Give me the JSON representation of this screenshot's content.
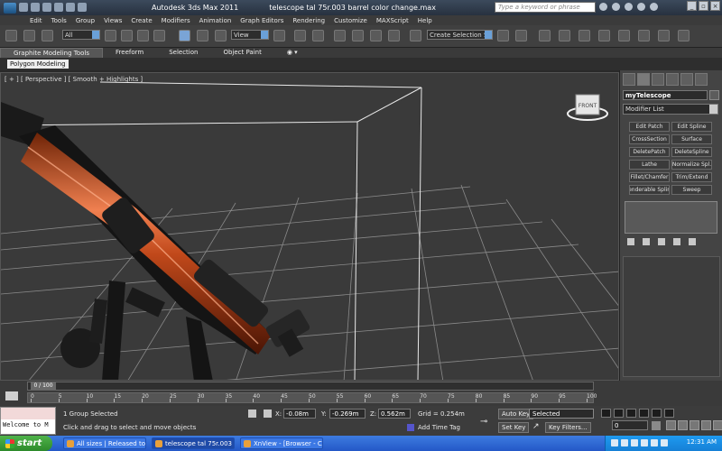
{
  "window": {
    "app_title": "Autodesk 3ds Max  2011",
    "file_title": "telescope tal 75r.003 barrel color change.max",
    "search_placeholder": "Type a keyword or phrase"
  },
  "menu": [
    "Edit",
    "Tools",
    "Group",
    "Views",
    "Create",
    "Modifiers",
    "Animation",
    "Graph Editors",
    "Rendering",
    "Customize",
    "MAXScript",
    "Help"
  ],
  "toolbar": {
    "selection_filter": "All",
    "ref_coord": "View",
    "named_selection": "Create Selection Se"
  },
  "ribbon": {
    "tabs": [
      "Graphite Modeling Tools",
      "Freeform",
      "Selection",
      "Object Paint"
    ],
    "active_tab": "Graphite Modeling Tools",
    "sub_label": "Polygon Modeling"
  },
  "viewport": {
    "label": "[ + ] [ Perspective ] [ Smooth + Highlights ]",
    "viewcube_label": "FRONT"
  },
  "command_panel": {
    "object_name": "myTelescope",
    "modifier_list": "Modifier List",
    "modifier_buttons": [
      "Edit Patch",
      "Edit Spline",
      "CrossSection",
      "Surface",
      "DeletePatch",
      "DeleteSpline",
      "Lathe",
      "Normalize Spl.",
      "Fillet/Chamfer",
      "Trim/Extend",
      "Renderable Spline",
      "Sweep"
    ]
  },
  "timeline": {
    "frame_display": "0 / 100",
    "ticks": [
      "0",
      "5",
      "10",
      "15",
      "20",
      "25",
      "30",
      "35",
      "40",
      "45",
      "50",
      "55",
      "60",
      "65",
      "70",
      "75",
      "80",
      "85",
      "90",
      "95",
      "100"
    ]
  },
  "status": {
    "listener_text": "Welcome to M",
    "selection": "1 Group Selected",
    "prompt": "Click and drag to select and move objects",
    "x_label": "X:",
    "x": "-0.08m",
    "y_label": "Y:",
    "y": "-0.269m",
    "z_label": "Z:",
    "z": "0.562m",
    "grid": "Grid = 0.254m",
    "add_time_tag": "Add Time Tag",
    "auto_key": "Auto Key",
    "set_key": "Set Key",
    "key_mode": "Selected",
    "key_filters": "Key Filters...",
    "current_frame": "0"
  },
  "taskbar": {
    "start": "start",
    "tasks": [
      "All sizes | Released to...",
      "telescope tal 75r.003 ...",
      "XnView - [Browser - C..."
    ],
    "clock": "12:31 AM"
  },
  "colors": {
    "viewport_bg": "#3a3a3a",
    "grid": "#9a9a9a",
    "barrel": "#c0481a",
    "taskbar": "#2458c7",
    "start": "#3a9c36"
  }
}
